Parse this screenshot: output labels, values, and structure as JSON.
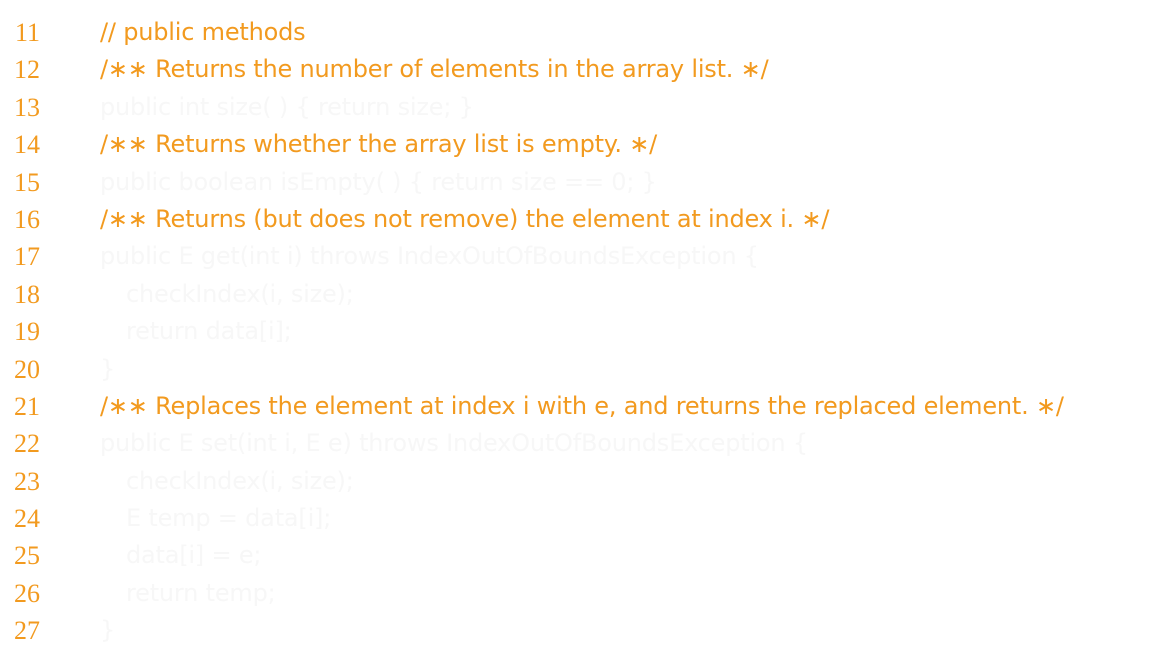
{
  "listing": {
    "accent_color": "#f29a1f",
    "faded_code_color": "#f7f7f7",
    "lines": [
      {
        "number": "11",
        "text": "// public methods",
        "indent": 0,
        "kind": "comment"
      },
      {
        "number": "12",
        "text": "/∗∗ Returns the number of elements in the array list. ∗/",
        "indent": 0,
        "kind": "comment"
      },
      {
        "number": "13",
        "text": "public int size( ) { return size; }",
        "indent": 0,
        "kind": "code"
      },
      {
        "number": "14",
        "text": "/∗∗ Returns whether the array list is empty. ∗/",
        "indent": 0,
        "kind": "comment"
      },
      {
        "number": "15",
        "text": "public boolean isEmpty( ) { return size == 0; }",
        "indent": 0,
        "kind": "code"
      },
      {
        "number": "16",
        "text": "/∗∗ Returns (but does not remove) the element at index i. ∗/",
        "indent": 0,
        "kind": "comment"
      },
      {
        "number": "17",
        "text": "public E get(int i) throws IndexOutOfBoundsException {",
        "indent": 0,
        "kind": "code"
      },
      {
        "number": "18",
        "text": "checkIndex(i, size);",
        "indent": 1,
        "kind": "code"
      },
      {
        "number": "19",
        "text": "return data[i];",
        "indent": 1,
        "kind": "code"
      },
      {
        "number": "20",
        "text": "}",
        "indent": 0,
        "kind": "code"
      },
      {
        "number": "21",
        "text": "/∗∗ Replaces the element at index i with e, and returns the replaced element. ∗/",
        "indent": 0,
        "kind": "comment"
      },
      {
        "number": "22",
        "text": "public E set(int i, E e) throws IndexOutOfBoundsException {",
        "indent": 0,
        "kind": "code"
      },
      {
        "number": "23",
        "text": "checkIndex(i, size);",
        "indent": 1,
        "kind": "code"
      },
      {
        "number": "24",
        "text": "E temp = data[i];",
        "indent": 1,
        "kind": "code"
      },
      {
        "number": "25",
        "text": "data[i] = e;",
        "indent": 1,
        "kind": "code"
      },
      {
        "number": "26",
        "text": "return temp;",
        "indent": 1,
        "kind": "code"
      },
      {
        "number": "27",
        "text": "}",
        "indent": 0,
        "kind": "code"
      }
    ]
  }
}
